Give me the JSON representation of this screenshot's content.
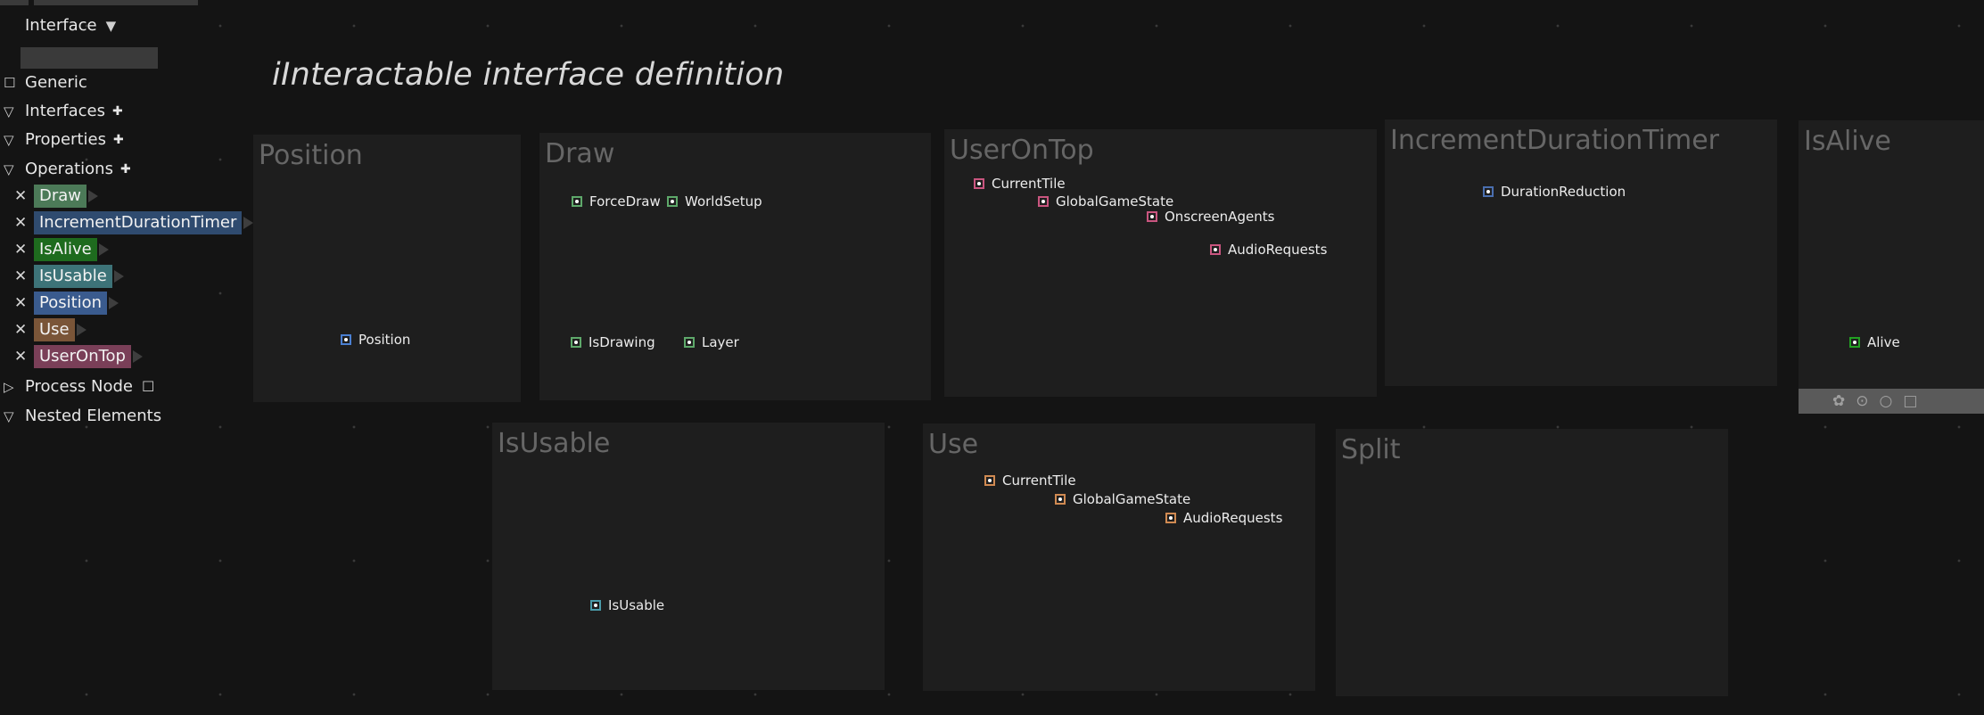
{
  "page_title": "iInteractable interface definition",
  "sidebar": {
    "interface_label": "Interface",
    "dropdown_glyph": "▼",
    "generic_label": "Generic",
    "interfaces_label": "Interfaces",
    "properties_label": "Properties",
    "operations_label": "Operations",
    "process_node_label": "Process Node",
    "nested_elements_label": "Nested Elements",
    "plus_glyph": "✚",
    "checkbox_glyph": "☐",
    "collapse_glyph": "▽",
    "expand_glyph": "▷",
    "remove_glyph": "✕",
    "operations": [
      {
        "label": "Draw",
        "color": "#4c7a58"
      },
      {
        "label": "IncrementDurationTimer",
        "color": "#2f4b6f"
      },
      {
        "label": "IsAlive",
        "color": "#1e6b1e"
      },
      {
        "label": "IsUsable",
        "color": "#3d7378"
      },
      {
        "label": "Position",
        "color": "#3a5b8e"
      },
      {
        "label": "Use",
        "color": "#7a5538"
      },
      {
        "label": "UserOnTop",
        "color": "#7a3f58"
      }
    ]
  },
  "panels": {
    "position": {
      "title": "Position",
      "ports": [
        {
          "label": "Position",
          "color": "#4a7fd1"
        }
      ]
    },
    "draw": {
      "title": "Draw",
      "ports": [
        {
          "label": "ForceDraw",
          "color": "#5ea86a"
        },
        {
          "label": "WorldSetup",
          "color": "#5ea86a"
        },
        {
          "label": "IsDrawing",
          "color": "#5ea86a"
        },
        {
          "label": "Layer",
          "color": "#5ea86a"
        }
      ]
    },
    "useronttop": {
      "title": "UserOnTop",
      "ports": [
        {
          "label": "CurrentTile",
          "color": "#c9557f"
        },
        {
          "label": "GlobalGameState",
          "color": "#c9557f"
        },
        {
          "label": "OnscreenAgents",
          "color": "#c9557f"
        },
        {
          "label": "AudioRequests",
          "color": "#c9557f"
        }
      ]
    },
    "increment": {
      "title": "IncrementDurationTimer",
      "ports": [
        {
          "label": "DurationReduction",
          "color": "#4a6fb0"
        }
      ]
    },
    "isalive": {
      "title": "IsAlive",
      "ports": [
        {
          "label": "Alive",
          "color": "#22a022"
        }
      ]
    },
    "isusable": {
      "title": "IsUsable",
      "ports": [
        {
          "label": "IsUsable",
          "color": "#4a9aa8"
        }
      ]
    },
    "use": {
      "title": "Use",
      "ports": [
        {
          "label": "CurrentTile",
          "color": "#d08a52"
        },
        {
          "label": "GlobalGameState",
          "color": "#d08a52"
        },
        {
          "label": "AudioRequests",
          "color": "#d08a52"
        }
      ]
    },
    "split": {
      "title": "Split"
    }
  },
  "toolbar_icons": [
    "palette-icon",
    "camera-icon",
    "circle-icon",
    "square-icon"
  ]
}
